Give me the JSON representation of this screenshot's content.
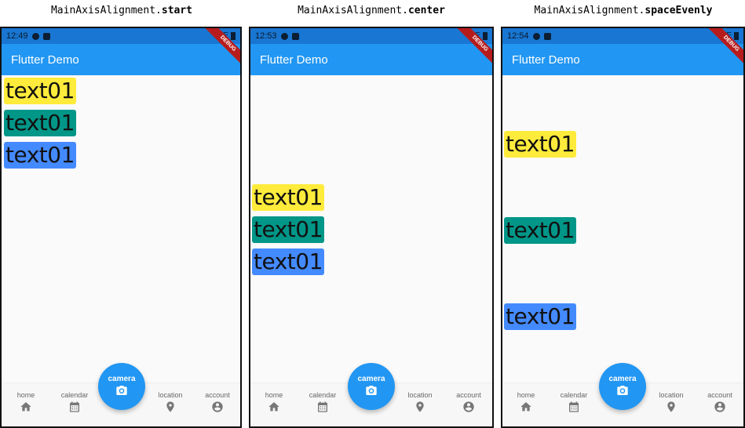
{
  "captions": [
    {
      "prefix": "MainAxisAlignment.",
      "value": "start"
    },
    {
      "prefix": "MainAxisAlignment.",
      "value": "center"
    },
    {
      "prefix": "MainAxisAlignment.",
      "value": "spaceEvenly"
    }
  ],
  "phones": [
    {
      "time": "12:49",
      "network": "LTE",
      "app_title": "Flutter Demo",
      "debug_label": "DEBUG"
    },
    {
      "time": "12:53",
      "network": "LTE",
      "app_title": "Flutter Demo",
      "debug_label": "DEBUG"
    },
    {
      "time": "12:54",
      "network": "LTE",
      "app_title": "Flutter Demo",
      "debug_label": "DEBUG"
    }
  ],
  "chips": {
    "text": "text01",
    "colors": {
      "yellow": "#ffeb3b",
      "teal": "#009688",
      "blue": "#448aff"
    }
  },
  "nav": {
    "items": [
      {
        "label": "home",
        "icon": "home-icon"
      },
      {
        "label": "calendar",
        "icon": "calendar-icon"
      },
      {
        "label": "location",
        "icon": "location-pin-icon"
      },
      {
        "label": "account",
        "icon": "account-circle-icon"
      }
    ],
    "fab_label": "camera",
    "fab_icon": "camera-icon"
  },
  "colors": {
    "appbar": "#2196f3",
    "statusbar": "#1976d2",
    "background": "#fafafa"
  }
}
